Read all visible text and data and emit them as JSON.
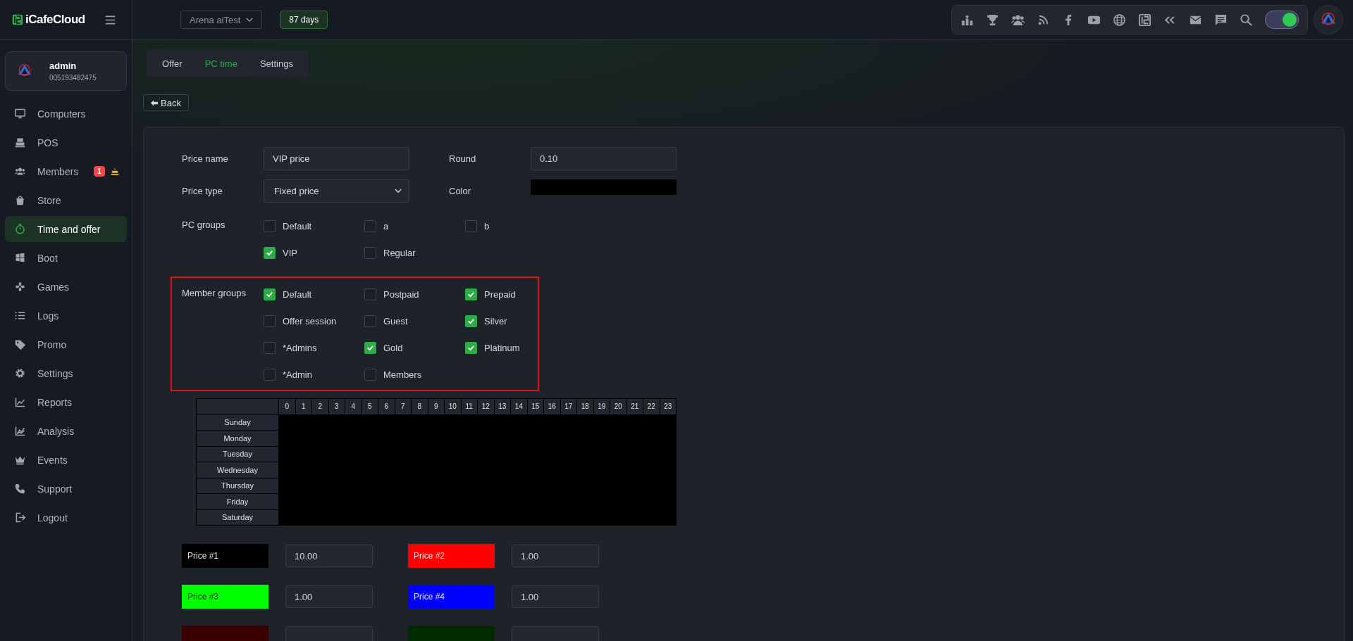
{
  "brand": {
    "name": "iCafeCloud"
  },
  "topbar": {
    "cafe_select": "Arena aiTest",
    "days_badge": "87 days",
    "toggle_on": true
  },
  "user": {
    "name": "admin",
    "id": "005193482475"
  },
  "sidebar": {
    "items": [
      {
        "label": "Computers",
        "kind": "monitor",
        "selected": false
      },
      {
        "label": "POS",
        "kind": "register",
        "selected": false
      },
      {
        "label": "Members",
        "kind": "people",
        "selected": false,
        "badge": "1"
      },
      {
        "label": "Store",
        "kind": "bag",
        "selected": false
      },
      {
        "label": "Time and offer",
        "kind": "timer",
        "selected": true
      },
      {
        "label": "Boot",
        "kind": "windows",
        "selected": false
      },
      {
        "label": "Games",
        "kind": "gamepad",
        "selected": false
      },
      {
        "label": "Logs",
        "kind": "list",
        "selected": false
      },
      {
        "label": "Promo",
        "kind": "tag",
        "selected": false
      },
      {
        "label": "Settings",
        "kind": "gear",
        "selected": false
      },
      {
        "label": "Reports",
        "kind": "line",
        "selected": false
      },
      {
        "label": "Analysis",
        "kind": "area",
        "selected": false
      },
      {
        "label": "Events",
        "kind": "crown",
        "selected": false
      },
      {
        "label": "Support",
        "kind": "phone",
        "selected": false
      },
      {
        "label": "Logout",
        "kind": "logout",
        "selected": false
      }
    ]
  },
  "tabs": [
    {
      "label": "Offer",
      "selected": false
    },
    {
      "label": "PC time",
      "selected": true
    },
    {
      "label": "Settings",
      "selected": false
    }
  ],
  "back_button": "Back",
  "form": {
    "price_name": {
      "label": "Price name",
      "value": "VIP price"
    },
    "round": {
      "label": "Round",
      "value": "0.10"
    },
    "price_type": {
      "label": "Price type",
      "value": "Fixed price"
    },
    "color": {
      "label": "Color",
      "color": "#000000"
    },
    "pc_groups": {
      "label": "PC groups",
      "highlighted": false,
      "items": [
        {
          "label": "Default",
          "checked": false
        },
        {
          "label": "a",
          "checked": false
        },
        {
          "label": "b",
          "checked": false
        },
        {
          "label": "VIP",
          "checked": true
        },
        {
          "label": "Regular",
          "checked": false
        }
      ]
    },
    "member_groups": {
      "label": "Member groups",
      "highlighted": true,
      "items": [
        {
          "label": "Default",
          "checked": true
        },
        {
          "label": "Postpaid",
          "checked": false
        },
        {
          "label": "Prepaid",
          "checked": true
        },
        {
          "label": "Offer session",
          "checked": false
        },
        {
          "label": "Guest",
          "checked": false
        },
        {
          "label": "Silver",
          "checked": true
        },
        {
          "label": "*Admins",
          "checked": false
        },
        {
          "label": "Gold",
          "checked": true
        },
        {
          "label": "Platinum",
          "checked": true
        },
        {
          "label": "*Admin",
          "checked": false
        },
        {
          "label": "Members",
          "checked": false
        }
      ]
    }
  },
  "schedule": {
    "hours": [
      "0",
      "1",
      "2",
      "3",
      "4",
      "5",
      "6",
      "7",
      "8",
      "9",
      "10",
      "11",
      "12",
      "13",
      "14",
      "15",
      "16",
      "17",
      "18",
      "19",
      "20",
      "21",
      "22",
      "23"
    ],
    "days": [
      "Sunday",
      "Monday",
      "Tuesday",
      "Wednesday",
      "Thursday",
      "Friday",
      "Saturday"
    ]
  },
  "prices": [
    {
      "label": "Price #1",
      "color": "#000000",
      "value": "10.00"
    },
    {
      "label": "Price #2",
      "color": "#ff0000",
      "value": "1.00"
    },
    {
      "label": "Price #3",
      "color": "#00ff00",
      "value": "1.00"
    },
    {
      "label": "Price #4",
      "color": "#0000ff",
      "value": "1.00"
    },
    {
      "color": "#3a0000"
    },
    {
      "color": "#002a00"
    }
  ]
}
